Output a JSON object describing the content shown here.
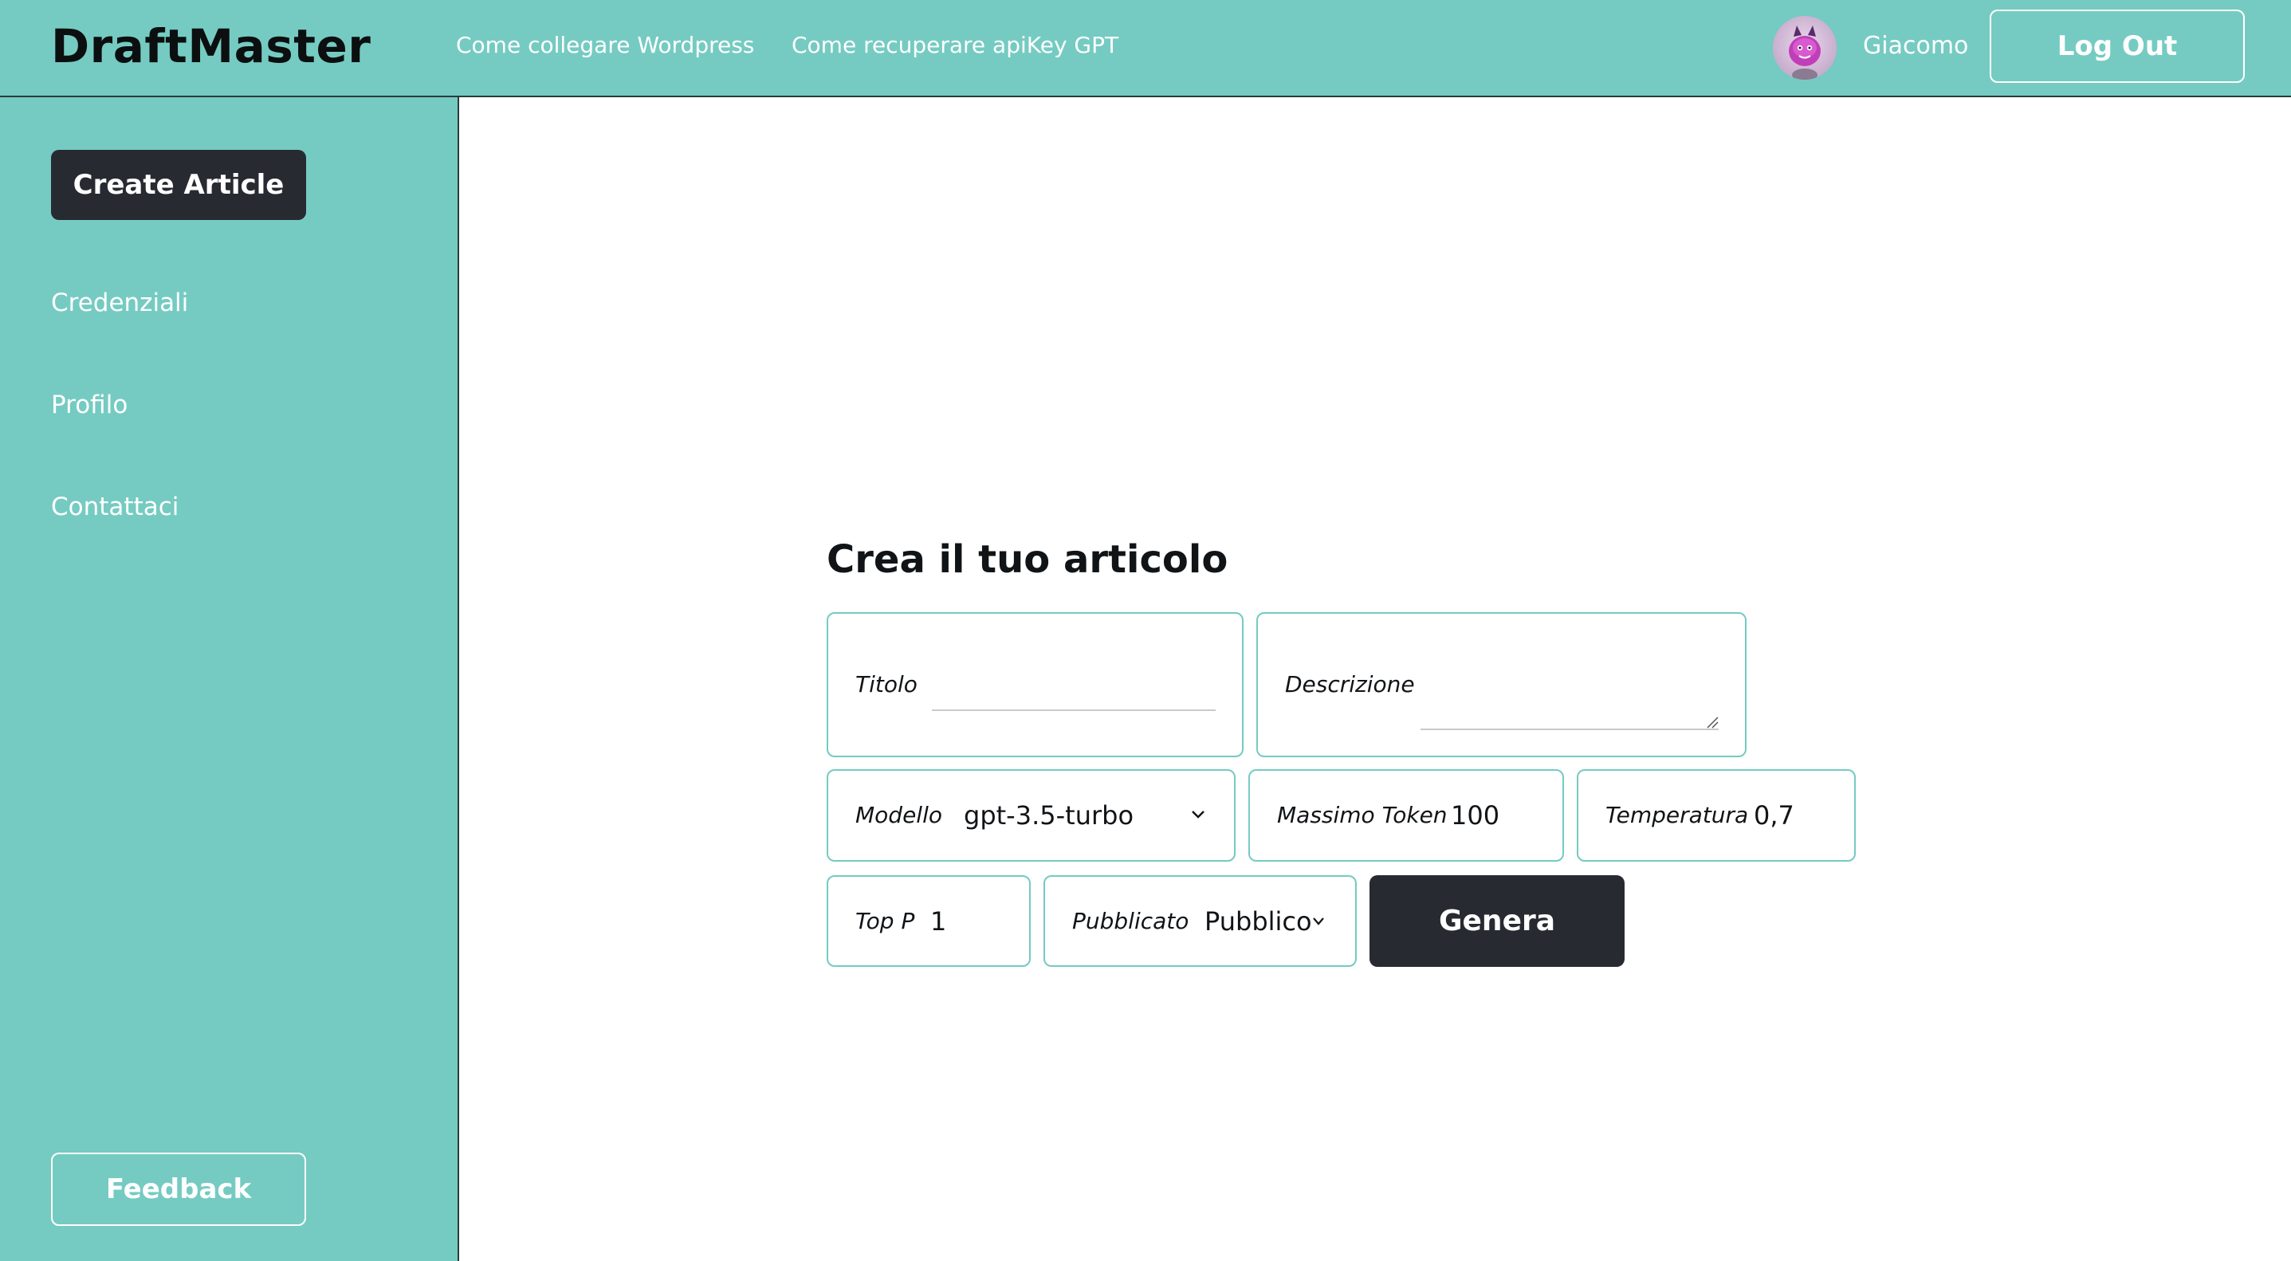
{
  "header": {
    "brand": "DraftMaster",
    "nav": [
      {
        "label": "Come collegare Wordpress"
      },
      {
        "label": "Come recuperare apiKey GPT"
      }
    ],
    "user": {
      "name": "Giacomo",
      "avatar_icon": "purple-monster-avatar"
    },
    "logout_label": "Log Out"
  },
  "sidebar": {
    "create_label": "Create Article",
    "items": [
      {
        "label": "Credenziali"
      },
      {
        "label": "Profilo"
      },
      {
        "label": "Contattaci"
      }
    ],
    "feedback_label": "Feedback"
  },
  "form": {
    "title": "Crea il tuo articolo",
    "titolo": {
      "label": "Titolo",
      "value": ""
    },
    "descrizione": {
      "label": "Descrizione",
      "value": ""
    },
    "modello": {
      "label": "Modello",
      "value": "gpt-3.5-turbo"
    },
    "massimo_token": {
      "label": "Massimo Token",
      "value": "100"
    },
    "temperatura": {
      "label": "Temperatura",
      "value": "0,7"
    },
    "top_p": {
      "label": "Top P",
      "value": "1"
    },
    "pubblicato": {
      "label": "Pubblicato",
      "value": "Pubblico"
    },
    "submit_label": "Genera"
  },
  "colors": {
    "accent": "#75cbc2",
    "dark_button": "#272b31",
    "field_border": "#74cbc2"
  }
}
